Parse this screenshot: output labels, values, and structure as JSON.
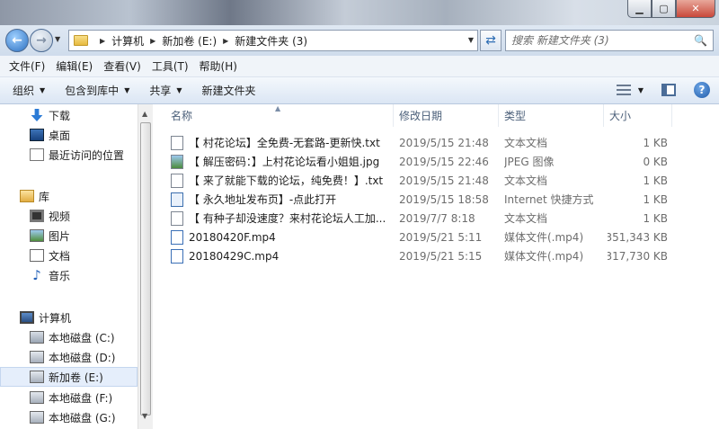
{
  "address": {
    "crumbs": [
      "计算机",
      "新加卷 (E:)",
      "新建文件夹 (3)"
    ]
  },
  "search": {
    "placeholder": "搜索 新建文件夹 (3)"
  },
  "menu": [
    "文件(F)",
    "编辑(E)",
    "查看(V)",
    "工具(T)",
    "帮助(H)"
  ],
  "toolbar": {
    "organize": "组织",
    "include_in_library": "包含到库中",
    "share": "共享",
    "new_folder": "新建文件夹"
  },
  "sidebar": {
    "items": [
      {
        "label": "下载",
        "icon": "download-icon"
      },
      {
        "label": "桌面",
        "icon": "desktop-icon"
      },
      {
        "label": "最近访问的位置",
        "icon": "recent-places-icon"
      },
      {
        "label": "库",
        "icon": "library-icon"
      },
      {
        "label": "视频",
        "icon": "video-icon"
      },
      {
        "label": "图片",
        "icon": "pictures-icon"
      },
      {
        "label": "文档",
        "icon": "documents-icon"
      },
      {
        "label": "音乐",
        "icon": "music-icon"
      },
      {
        "label": "计算机",
        "icon": "computer-icon"
      },
      {
        "label": "本地磁盘 (C:)",
        "icon": "system-drive-icon"
      },
      {
        "label": "本地磁盘 (D:)",
        "icon": "drive-icon"
      },
      {
        "label": "新加卷 (E:)",
        "icon": "drive-icon",
        "selected": true
      },
      {
        "label": "本地磁盘 (F:)",
        "icon": "drive-icon"
      },
      {
        "label": "本地磁盘 (G:)",
        "icon": "drive-icon"
      }
    ]
  },
  "columns": {
    "name": "名称",
    "date": "修改日期",
    "type": "类型",
    "size": "大小"
  },
  "files": [
    {
      "name": "【 村花论坛】全免费-无套路-更新快.txt",
      "date": "2019/5/15 21:48",
      "type": "文本文档",
      "size": "1 KB",
      "icon": "text-file-icon"
    },
    {
      "name": "【 解压密码：】上村花论坛看小姐姐.jpg",
      "date": "2019/5/15 22:46",
      "type": "JPEG 图像",
      "size": "0 KB",
      "icon": "image-file-icon"
    },
    {
      "name": "【 来了就能下载的论坛，纯免费！】.txt",
      "date": "2019/5/15 21:48",
      "type": "文本文档",
      "size": "1 KB",
      "icon": "text-file-icon"
    },
    {
      "name": "【 永久地址发布页】-点此打开",
      "date": "2019/5/15 18:58",
      "type": "Internet 快捷方式",
      "size": "1 KB",
      "icon": "shortcut-file-icon"
    },
    {
      "name": "【 有种子却没速度？来村花论坛人工加...",
      "date": "2019/7/7 8:18",
      "type": "文本文档",
      "size": "1 KB",
      "icon": "text-file-icon"
    },
    {
      "name": "20180420F.mp4",
      "date": "2019/5/21 5:11",
      "type": "媒体文件(.mp4)",
      "size": "351,343 KB",
      "icon": "video-file-icon"
    },
    {
      "name": "20180429C.mp4",
      "date": "2019/5/21 5:15",
      "type": "媒体文件(.mp4)",
      "size": "317,730 KB",
      "icon": "video-file-icon"
    }
  ]
}
